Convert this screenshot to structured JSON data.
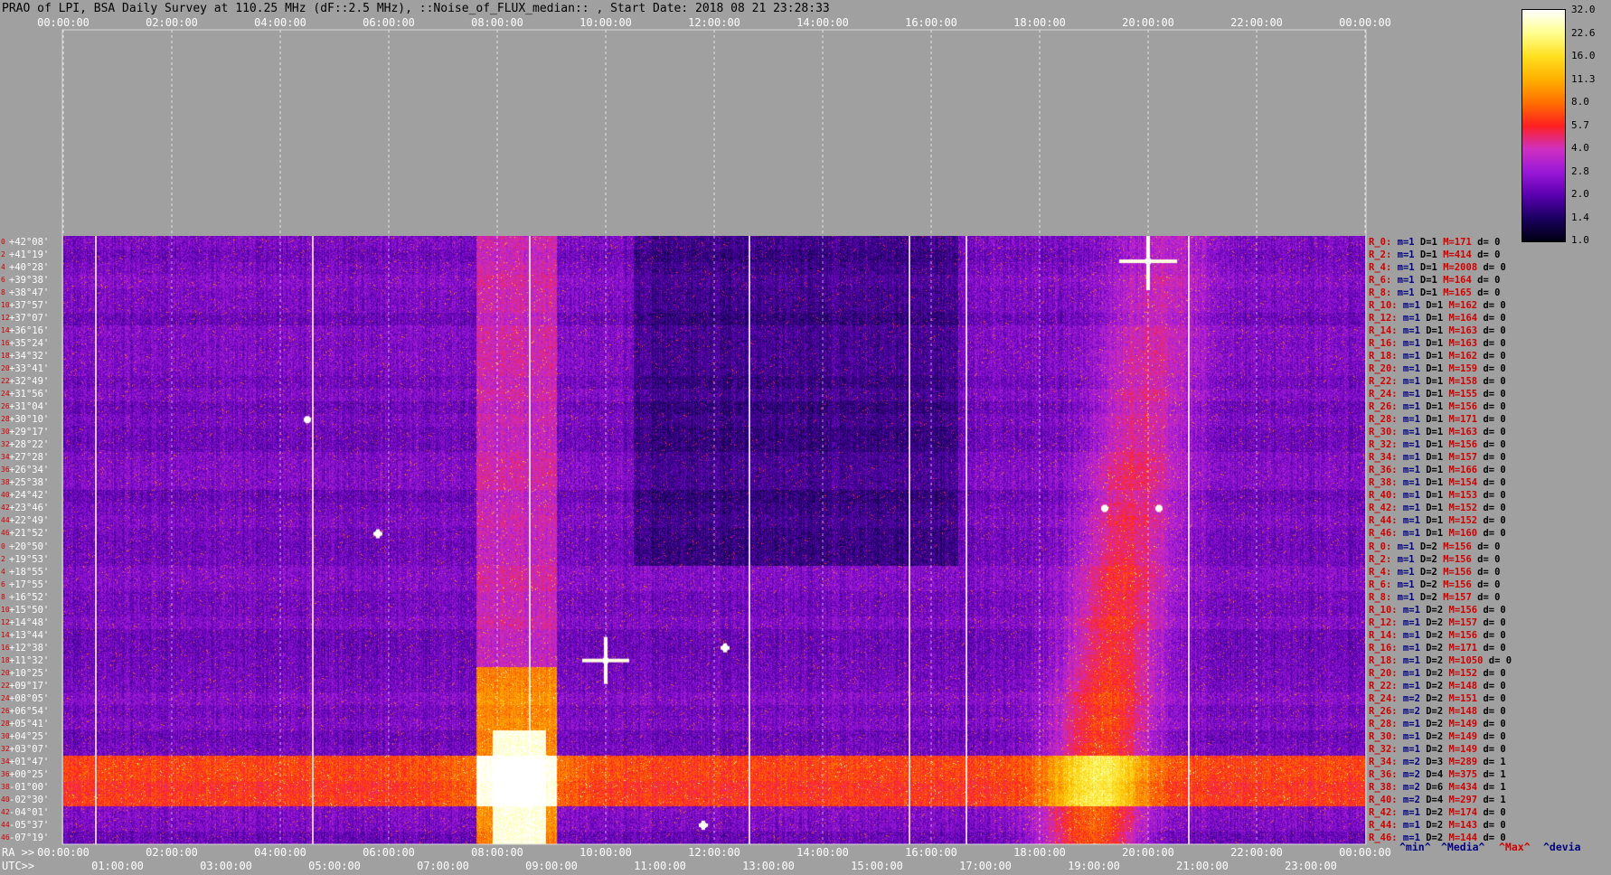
{
  "title": "PRAO of LPI, BSA Daily Survey at 110.25 MHz (dF::2.5 MHz), ::Noise_of_FLUX_median:: , Start Date: 2018 08 21 23:28:33",
  "top_axis_ticks": [
    "00:00:00",
    "02:00:00",
    "04:00:00",
    "06:00:00",
    "08:00:00",
    "10:00:00",
    "12:00:00",
    "14:00:00",
    "16:00:00",
    "18:00:00",
    "20:00:00",
    "22:00:00",
    "00:00:00"
  ],
  "ra_label": "RA >>",
  "ra_ticks": [
    "00:00:00",
    "02:00:00",
    "04:00:00",
    "06:00:00",
    "08:00:00",
    "10:00:00",
    "12:00:00",
    "14:00:00",
    "16:00:00",
    "18:00:00",
    "20:00:00",
    "22:00:00",
    "00:00:00"
  ],
  "utc_label": "UTC>>",
  "utc_ticks": [
    "01:00:00",
    "03:00:00",
    "05:00:00",
    "07:00:00",
    "09:00:00",
    "11:00:00",
    "13:00:00",
    "15:00:00",
    "17:00:00",
    "19:00:00",
    "21:00:00",
    "23:00:00"
  ],
  "colorbar": {
    "ticks": [
      "32.0",
      "22.6",
      "16.0",
      "11.3",
      "8.0",
      "5.7",
      "4.0",
      "2.8",
      "2.0",
      "1.4",
      "1.0"
    ],
    "colors": [
      "#000010",
      "#1a0060",
      "#5a00b0",
      "#9a18d8",
      "#d030c0",
      "#ff2020",
      "#ff7000",
      "#ffb000",
      "#ffe020",
      "#ffff90",
      "#ffffff"
    ]
  },
  "legend_keys": {
    "min": "^min^",
    "median": "^Media^",
    "max": "^Max^",
    "devia": "^devia"
  },
  "chart_data": {
    "type": "heatmap",
    "title": "PRAO of LPI, BSA Daily Survey at 110.25 MHz (dF::2.5 MHz), ::Noise_of_FLUX_median:: , Start Date: 2018 08 21 23:28:33",
    "x_axis": "RA / UTC (hours)",
    "x_range_hours": [
      0,
      24
    ],
    "color_scale": "log",
    "color_range": [
      1.0,
      32.0
    ],
    "rows": [
      {
        "idx": "0",
        "dec": "+42°08'",
        "stat": {
          "r": "R_0:",
          "m": "m=1",
          "d": "D=1",
          "mx": "M=171",
          "dv": "d= 0"
        }
      },
      {
        "idx": "2",
        "dec": "+41°19'",
        "stat": {
          "r": "R_2:",
          "m": "m=1",
          "d": "D=1",
          "mx": "M=414",
          "dv": "d= 0"
        }
      },
      {
        "idx": "4",
        "dec": "+40°28'",
        "stat": {
          "r": "R_4:",
          "m": "m=1",
          "d": "D=1",
          "mx": "M=2008",
          "dv": "d= 0"
        }
      },
      {
        "idx": "6",
        "dec": "+39°38'",
        "stat": {
          "r": "R_6:",
          "m": "m=1",
          "d": "D=1",
          "mx": "M=164",
          "dv": "d= 0"
        }
      },
      {
        "idx": "8",
        "dec": "+38°47'",
        "stat": {
          "r": "R_8:",
          "m": "m=1",
          "d": "D=1",
          "mx": "M=165",
          "dv": "d= 0"
        }
      },
      {
        "idx": "10",
        "dec": "+37°57'",
        "stat": {
          "r": "R_10:",
          "m": "m=1",
          "d": "D=1",
          "mx": "M=162",
          "dv": "d= 0"
        }
      },
      {
        "idx": "12",
        "dec": "+37°07'",
        "stat": {
          "r": "R_12:",
          "m": "m=1",
          "d": "D=1",
          "mx": "M=164",
          "dv": "d= 0"
        }
      },
      {
        "idx": "14",
        "dec": "+36°16'",
        "stat": {
          "r": "R_14:",
          "m": "m=1",
          "d": "D=1",
          "mx": "M=163",
          "dv": "d= 0"
        }
      },
      {
        "idx": "16",
        "dec": "+35°24'",
        "stat": {
          "r": "R_16:",
          "m": "m=1",
          "d": "D=1",
          "mx": "M=163",
          "dv": "d= 0"
        }
      },
      {
        "idx": "18",
        "dec": "+34°32'",
        "stat": {
          "r": "R_18:",
          "m": "m=1",
          "d": "D=1",
          "mx": "M=162",
          "dv": "d= 0"
        }
      },
      {
        "idx": "20",
        "dec": "+33°41'",
        "stat": {
          "r": "R_20:",
          "m": "m=1",
          "d": "D=1",
          "mx": "M=159",
          "dv": "d= 0"
        }
      },
      {
        "idx": "22",
        "dec": "+32°49'",
        "stat": {
          "r": "R_22:",
          "m": "m=1",
          "d": "D=1",
          "mx": "M=158",
          "dv": "d= 0"
        }
      },
      {
        "idx": "24",
        "dec": "+31°56'",
        "stat": {
          "r": "R_24:",
          "m": "m=1",
          "d": "D=1",
          "mx": "M=155",
          "dv": "d= 0"
        }
      },
      {
        "idx": "26",
        "dec": "+31°04'",
        "stat": {
          "r": "R_26:",
          "m": "m=1",
          "d": "D=1",
          "mx": "M=156",
          "dv": "d= 0"
        }
      },
      {
        "idx": "28",
        "dec": "+30°10'",
        "stat": {
          "r": "R_28:",
          "m": "m=1",
          "d": "D=1",
          "mx": "M=171",
          "dv": "d= 0"
        }
      },
      {
        "idx": "30",
        "dec": "+29°17'",
        "stat": {
          "r": "R_30:",
          "m": "m=1",
          "d": "D=1",
          "mx": "M=163",
          "dv": "d= 0"
        }
      },
      {
        "idx": "32",
        "dec": "+28°22'",
        "stat": {
          "r": "R_32:",
          "m": "m=1",
          "d": "D=1",
          "mx": "M=156",
          "dv": "d= 0"
        }
      },
      {
        "idx": "34",
        "dec": "+27°28'",
        "stat": {
          "r": "R_34:",
          "m": "m=1",
          "d": "D=1",
          "mx": "M=157",
          "dv": "d= 0"
        }
      },
      {
        "idx": "36",
        "dec": "+26°34'",
        "stat": {
          "r": "R_36:",
          "m": "m=1",
          "d": "D=1",
          "mx": "M=166",
          "dv": "d= 0"
        }
      },
      {
        "idx": "38",
        "dec": "+25°38'",
        "stat": {
          "r": "R_38:",
          "m": "m=1",
          "d": "D=1",
          "mx": "M=154",
          "dv": "d= 0"
        }
      },
      {
        "idx": "40",
        "dec": "+24°42'",
        "stat": {
          "r": "R_40:",
          "m": "m=1",
          "d": "D=1",
          "mx": "M=153",
          "dv": "d= 0"
        }
      },
      {
        "idx": "42",
        "dec": "+23°46'",
        "stat": {
          "r": "R_42:",
          "m": "m=1",
          "d": "D=1",
          "mx": "M=152",
          "dv": "d= 0"
        }
      },
      {
        "idx": "44",
        "dec": "+22°49'",
        "stat": {
          "r": "R_44:",
          "m": "m=1",
          "d": "D=1",
          "mx": "M=152",
          "dv": "d= 0"
        }
      },
      {
        "idx": "46",
        "dec": "+21°52'",
        "stat": {
          "r": "R_46:",
          "m": "m=1",
          "d": "D=1",
          "mx": "M=160",
          "dv": "d= 0"
        }
      },
      {
        "idx": "0",
        "dec": "+20°50'",
        "stat": {
          "r": "R_0:",
          "m": "m=1",
          "d": "D=2",
          "mx": "M=156",
          "dv": "d= 0"
        }
      },
      {
        "idx": "2",
        "dec": "+19°53'",
        "stat": {
          "r": "R_2:",
          "m": "m=1",
          "d": "D=2",
          "mx": "M=156",
          "dv": "d= 0"
        }
      },
      {
        "idx": "4",
        "dec": "+18°55'",
        "stat": {
          "r": "R_4:",
          "m": "m=1",
          "d": "D=2",
          "mx": "M=156",
          "dv": "d= 0"
        }
      },
      {
        "idx": "6",
        "dec": "+17°55'",
        "stat": {
          "r": "R_6:",
          "m": "m=1",
          "d": "D=2",
          "mx": "M=156",
          "dv": "d= 0"
        }
      },
      {
        "idx": "8",
        "dec": "+16°52'",
        "stat": {
          "r": "R_8:",
          "m": "m=1",
          "d": "D=2",
          "mx": "M=157",
          "dv": "d= 0"
        }
      },
      {
        "idx": "10",
        "dec": "+15°50'",
        "stat": {
          "r": "R_10:",
          "m": "m=1",
          "d": "D=2",
          "mx": "M=156",
          "dv": "d= 0"
        }
      },
      {
        "idx": "12",
        "dec": "+14°48'",
        "stat": {
          "r": "R_12:",
          "m": "m=1",
          "d": "D=2",
          "mx": "M=157",
          "dv": "d= 0"
        }
      },
      {
        "idx": "14",
        "dec": "+13°44'",
        "stat": {
          "r": "R_14:",
          "m": "m=1",
          "d": "D=2",
          "mx": "M=156",
          "dv": "d= 0"
        }
      },
      {
        "idx": "16",
        "dec": "+12°38'",
        "stat": {
          "r": "R_16:",
          "m": "m=1",
          "d": "D=2",
          "mx": "M=171",
          "dv": "d= 0"
        }
      },
      {
        "idx": "18",
        "dec": "+11°32'",
        "stat": {
          "r": "R_18:",
          "m": "m=1",
          "d": "D=2",
          "mx": "M=1050",
          "dv": "d= 0"
        }
      },
      {
        "idx": "20",
        "dec": "+10°25'",
        "stat": {
          "r": "R_20:",
          "m": "m=1",
          "d": "D=2",
          "mx": "M=152",
          "dv": "d= 0"
        }
      },
      {
        "idx": "22",
        "dec": "+09°17'",
        "stat": {
          "r": "R_22:",
          "m": "m=1",
          "d": "D=2",
          "mx": "M=148",
          "dv": "d= 0"
        }
      },
      {
        "idx": "24",
        "dec": "+08°05'",
        "stat": {
          "r": "R_24:",
          "m": "m=2",
          "d": "D=2",
          "mx": "M=151",
          "dv": "d= 0"
        }
      },
      {
        "idx": "26",
        "dec": "+06°54'",
        "stat": {
          "r": "R_26:",
          "m": "m=2",
          "d": "D=2",
          "mx": "M=148",
          "dv": "d= 0"
        }
      },
      {
        "idx": "28",
        "dec": "+05°41'",
        "stat": {
          "r": "R_28:",
          "m": "m=1",
          "d": "D=2",
          "mx": "M=149",
          "dv": "d= 0"
        }
      },
      {
        "idx": "30",
        "dec": "+04°25'",
        "stat": {
          "r": "R_30:",
          "m": "m=1",
          "d": "D=2",
          "mx": "M=149",
          "dv": "d= 0"
        }
      },
      {
        "idx": "32",
        "dec": "+03°07'",
        "stat": {
          "r": "R_32:",
          "m": "m=1",
          "d": "D=2",
          "mx": "M=149",
          "dv": "d= 0"
        }
      },
      {
        "idx": "34",
        "dec": "+01°47'",
        "stat": {
          "r": "R_34:",
          "m": "m=2",
          "d": "D=3",
          "mx": "M=289",
          "dv": "d= 1"
        }
      },
      {
        "idx": "36",
        "dec": "+00°25'",
        "stat": {
          "r": "R_36:",
          "m": "m=2",
          "d": "D=4",
          "mx": "M=375",
          "dv": "d= 1"
        }
      },
      {
        "idx": "38",
        "dec": "-01°00'",
        "stat": {
          "r": "R_38:",
          "m": "m=2",
          "d": "D=6",
          "mx": "M=434",
          "dv": "d= 1"
        }
      },
      {
        "idx": "40",
        "dec": "-02°30'",
        "stat": {
          "r": "R_40:",
          "m": "m=2",
          "d": "D=4",
          "mx": "M=297",
          "dv": "d= 1"
        }
      },
      {
        "idx": "42",
        "dec": "-04°01'",
        "stat": {
          "r": "R_42:",
          "m": "m=1",
          "d": "D=2",
          "mx": "M=174",
          "dv": "d= 0"
        }
      },
      {
        "idx": "44",
        "dec": "-05°37'",
        "stat": {
          "r": "R_44:",
          "m": "m=1",
          "d": "D=2",
          "mx": "M=143",
          "dv": "d= 0"
        }
      },
      {
        "idx": "46",
        "dec": "-07°19'",
        "stat": {
          "r": "R_46:",
          "m": "m=1",
          "d": "D=2",
          "mx": "M=144",
          "dv": "d= 0"
        }
      }
    ],
    "features": [
      {
        "name": "bright continuum band",
        "ra_hours": [
          7.5,
          9.2
        ],
        "dec_rows": [
          34,
          47
        ],
        "level": "saturated"
      },
      {
        "name": "horizontal equatorial band",
        "ra_hours": [
          0,
          24
        ],
        "dec_rows": [
          42,
          45
        ],
        "level": "high"
      },
      {
        "name": "milky-way diffuse arc",
        "ra_hours": [
          18.5,
          21.0
        ],
        "dec_rows": [
          18,
          47
        ],
        "level": "medium"
      },
      {
        "name": "cross source",
        "ra_hours": [
          20.0,
          20.0
        ],
        "dec_rows": [
          1,
          2
        ],
        "level": "saturated"
      },
      {
        "name": "cross source",
        "ra_hours": [
          10.0,
          10.0
        ],
        "dec_rows": [
          33,
          33
        ],
        "level": "saturated"
      }
    ]
  }
}
